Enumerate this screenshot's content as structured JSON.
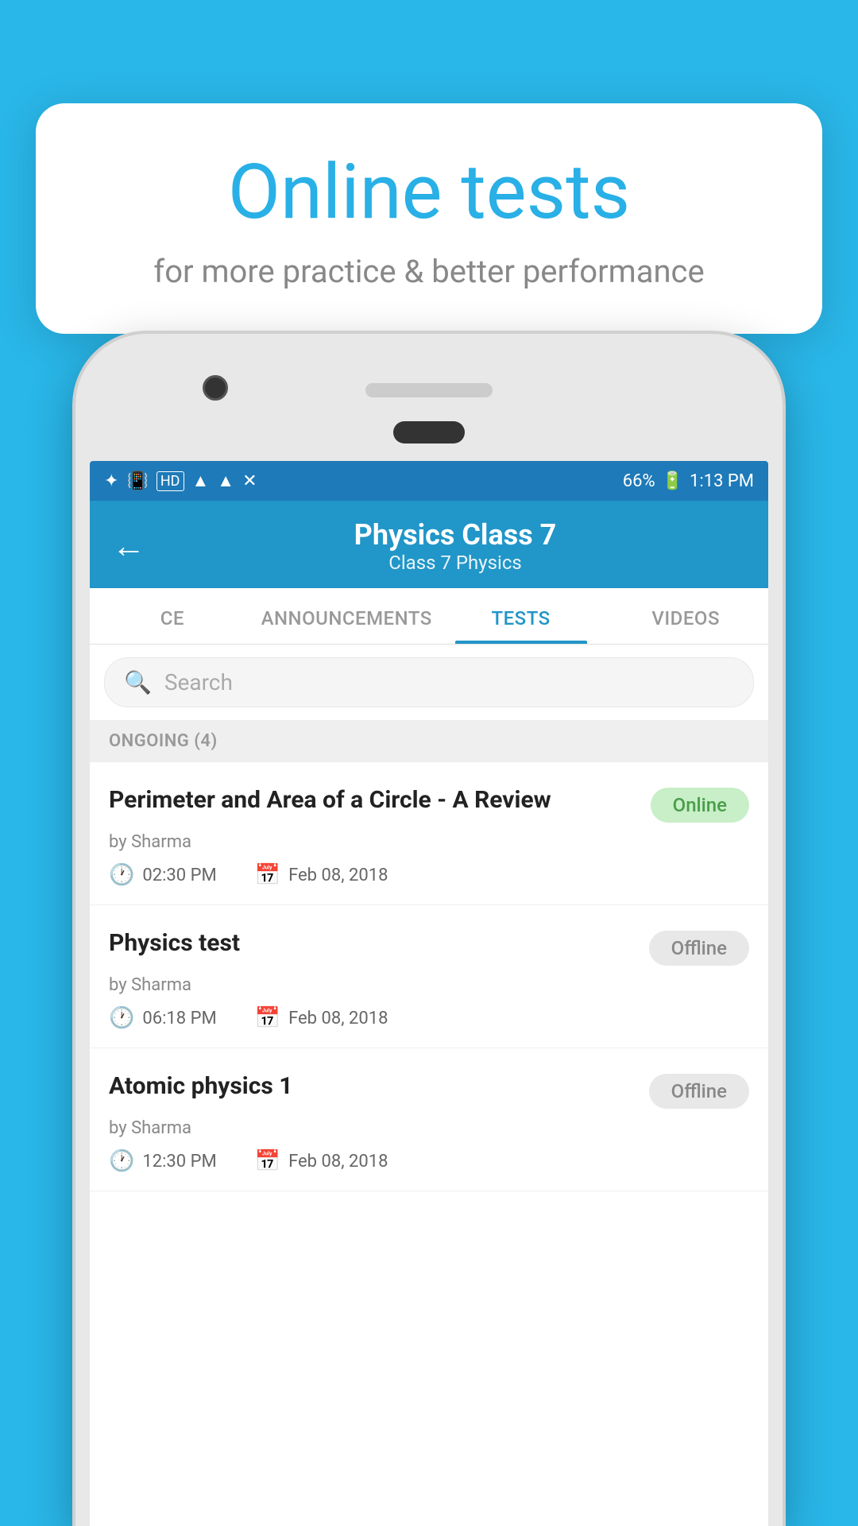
{
  "background_color": "#29b6e8",
  "speech_bubble": {
    "title": "Online tests",
    "subtitle": "for more practice & better performance"
  },
  "status_bar": {
    "time": "1:13 PM",
    "battery": "66%",
    "icons": "bluetooth vibrate hd wifi signal"
  },
  "app_bar": {
    "title": "Physics Class 7",
    "subtitle": "Class 7   Physics",
    "back_label": "←"
  },
  "tabs": [
    {
      "label": "CE",
      "active": false
    },
    {
      "label": "ANNOUNCEMENTS",
      "active": false
    },
    {
      "label": "TESTS",
      "active": true
    },
    {
      "label": "VIDEOS",
      "active": false
    }
  ],
  "search": {
    "placeholder": "Search"
  },
  "section": {
    "label": "ONGOING (4)"
  },
  "tests": [
    {
      "title": "Perimeter and Area of a Circle - A Review",
      "author": "by Sharma",
      "status": "Online",
      "status_type": "online",
      "time": "02:30 PM",
      "date": "Feb 08, 2018"
    },
    {
      "title": "Physics test",
      "author": "by Sharma",
      "status": "Offline",
      "status_type": "offline",
      "time": "06:18 PM",
      "date": "Feb 08, 2018"
    },
    {
      "title": "Atomic physics 1",
      "author": "by Sharma",
      "status": "Offline",
      "status_type": "offline",
      "time": "12:30 PM",
      "date": "Feb 08, 2018"
    }
  ]
}
